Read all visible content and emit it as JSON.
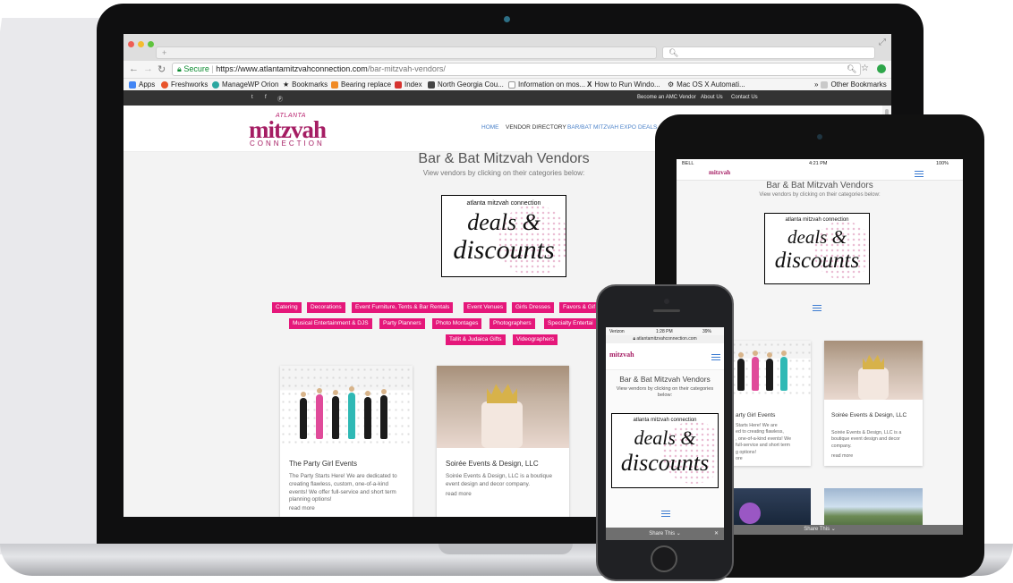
{
  "browser": {
    "url_secure_label": "Secure",
    "url_host": "https://www.atlantamitzvahconnection.com",
    "url_path": "/bar-mitzvah-vendors/",
    "bookmarks": [
      {
        "label": "Apps",
        "color": "#4285f4"
      },
      {
        "label": "Freshworks",
        "color": "#e8532a"
      },
      {
        "label": "ManageWP Orion",
        "color": "#2aa7a0"
      },
      {
        "label": "Bookmarks",
        "color": "#666666"
      },
      {
        "label": "Bearing replace",
        "color": "#f08a24"
      },
      {
        "label": "Index",
        "color": "#d6332f"
      },
      {
        "label": "North Georgia Cou...",
        "color": "#444444"
      },
      {
        "label": "Information on mos...",
        "color": "#888888"
      },
      {
        "label": "How to Run Windo...",
        "color": "#111111"
      },
      {
        "label": "Mac OS X Automati...",
        "color": "#777777"
      }
    ],
    "other_bookmarks": "Other Bookmarks"
  },
  "site": {
    "topbar_links": [
      "Become an AMC Vendor",
      "About Us",
      "Contact Us"
    ],
    "logo_top": "ATLANTA",
    "logo_main": "mitzvah",
    "logo_bottom": "CONNECTION",
    "nav": [
      "HOME",
      "VENDOR DIRECTORY",
      "BAR/BAT MITZVAH EXPO",
      "DEALS"
    ],
    "title": "Bar & Bat Mitzvah Vendors",
    "subtitle": "View vendors by clicking on their categories below:",
    "deals_header": "atlanta mitzvah connection",
    "deals_line1": "deals &",
    "deals_line2": "discounts",
    "categories_row1": [
      "Catering",
      "Decorations",
      "Event Furniture, Tents & Bar Rentals",
      "Event Venues",
      "Girls Dresses",
      "Favors & Gif"
    ],
    "categories_row2": [
      "Musical Entertainment & DJS",
      "Party Planners",
      "Photo Montages",
      "Photographers",
      "Specialty Entertai"
    ],
    "categories_row3": [
      "Tallit & Judaica Gifts",
      "Videographers"
    ],
    "cards": [
      {
        "title": "The Party Girl Events",
        "desc": "The Party Starts Here! We are dedicated to creating flawless, custom, one-of-a-kind events! We offer full-service and short term planning options!",
        "more": "read more"
      },
      {
        "title": "Soirée Events & Design, LLC",
        "desc": "Soirée Events & Design, LLC is a boutique event design and decor company.",
        "more": "read more"
      }
    ]
  },
  "tablet": {
    "carrier": "BELL",
    "time": "4:21 PM",
    "battery": "100%",
    "title": "Bar & Bat Mitzvah Vendors",
    "subtitle": "View vendors by clicking on their categories below:",
    "card1_title": "arty Girl Events",
    "card1_desc": "Starts Here! We are\ned to creating flawless,\n, one-of-a-kind events! We\nfull-service and short term\ng options!\nore",
    "card2_title": "Soirée Events & Design, LLC",
    "card2_desc": "Soirée Events & Design, LLC is a boutique event design and decor company.",
    "card2_more": "read more",
    "share": "Share This"
  },
  "phone": {
    "carrier": "Verizon",
    "time": "1:28 PM",
    "battery": "39%",
    "url": "atlantamitzvahconnection.com",
    "title": "Bar & Bat Mitzvah Vendors",
    "subtitle": "View vendors by clicking on their categories below:",
    "share": "Share This"
  }
}
